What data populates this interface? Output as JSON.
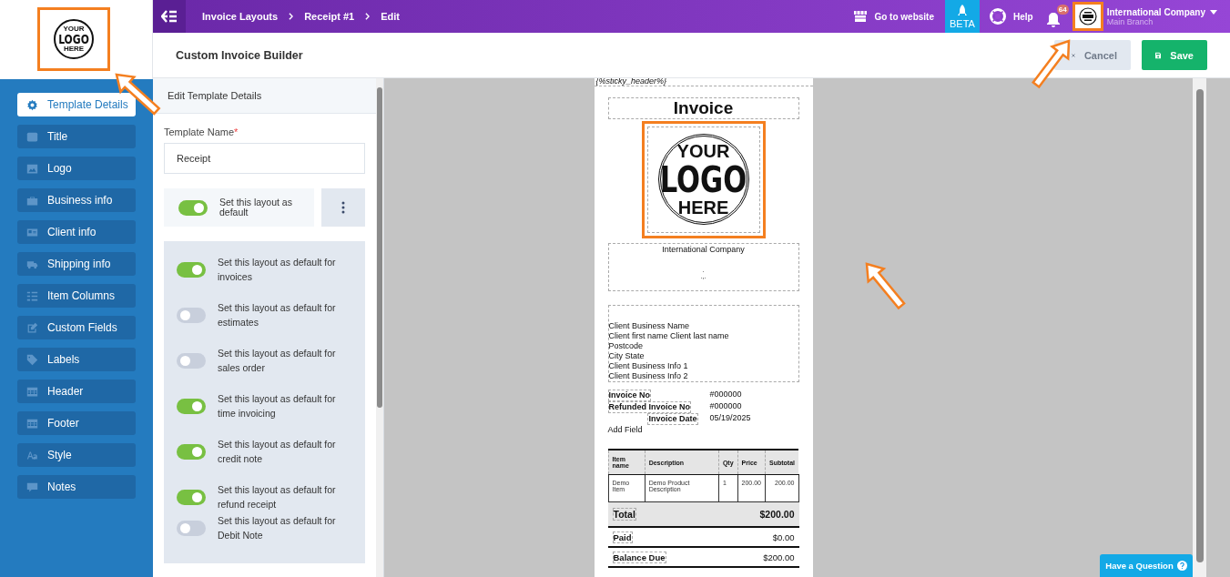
{
  "sidebar": {
    "logo": [
      "YOUR",
      "LOGO",
      "HERE"
    ],
    "items": [
      {
        "label": "Template Details",
        "selected": true
      },
      {
        "label": "Title",
        "selected": false
      },
      {
        "label": "Logo",
        "selected": false
      },
      {
        "label": "Business info",
        "selected": false
      },
      {
        "label": "Client info",
        "selected": false
      },
      {
        "label": "Shipping info",
        "selected": false
      },
      {
        "label": "Item Columns",
        "selected": false
      },
      {
        "label": "Custom Fields",
        "selected": false
      },
      {
        "label": "Labels",
        "selected": false
      },
      {
        "label": "Header",
        "selected": false
      },
      {
        "label": "Footer",
        "selected": false
      },
      {
        "label": "Style",
        "selected": false
      },
      {
        "label": "Notes",
        "selected": false
      }
    ]
  },
  "topbar": {
    "breadcrumbs": [
      "Invoice Layouts",
      "Receipt #1",
      "Edit"
    ],
    "go_to_website": "Go to website",
    "beta": "BETA",
    "help": "Help",
    "notifications": "64",
    "company": "International Company",
    "branch": "Main Branch"
  },
  "header": {
    "title": "Custom Invoice Builder",
    "cancel": "Cancel",
    "save": "Save"
  },
  "editor": {
    "title": "Edit Template Details",
    "template_name_label": "Template Name",
    "required_mark": "*",
    "template_name": "Receipt",
    "default_toggle": {
      "label": "Set this layout as default",
      "on": true
    },
    "toggles": [
      {
        "label": "Set this layout as default for invoices",
        "on": true
      },
      {
        "label": "Set this layout as default for estimates",
        "on": false
      },
      {
        "label": "Set this layout as default for sales order",
        "on": false
      },
      {
        "label": "Set this layout as default for time invoicing",
        "on": true
      },
      {
        "label": "Set this layout as default for credit note",
        "on": true
      },
      {
        "label": "Set this layout as default for refund receipt",
        "on": true
      },
      {
        "label": "Set this layout as default for Debit Note",
        "on": false
      }
    ]
  },
  "invoice": {
    "sticky_header": "{%sticky_header%}",
    "title": "Invoice",
    "logo": [
      "YOUR",
      "LOGO",
      "HERE"
    ],
    "company": "International Company",
    "address": [
      ".",
      ".,."
    ],
    "client": [
      "Client Business Name",
      "Client first name Client last name",
      "Postcode",
      "City State",
      "Client Business Info 1",
      "Client Business Info 2"
    ],
    "meta": [
      {
        "label": "Invoice No",
        "value": "#000000"
      },
      {
        "label": "Refunded Invoice No",
        "value": "#000000"
      },
      {
        "label": "Invoice Date",
        "value": "05/19/2025"
      }
    ],
    "add_field": "Add Field",
    "columns": [
      "Item name",
      "Description",
      "Qty",
      "Price",
      "Subtotal"
    ],
    "rows": [
      [
        "Demo Item",
        "Demo Product Description",
        "1",
        "200.00",
        "200.00"
      ]
    ],
    "totals": [
      {
        "label": "Total",
        "value": "$200.00",
        "highlighted": true
      },
      {
        "label": "Paid",
        "value": "$0.00",
        "highlighted": false
      },
      {
        "label": "Balance Due",
        "value": "$200.00",
        "highlighted": false
      }
    ]
  },
  "help_button": "Have a Question"
}
